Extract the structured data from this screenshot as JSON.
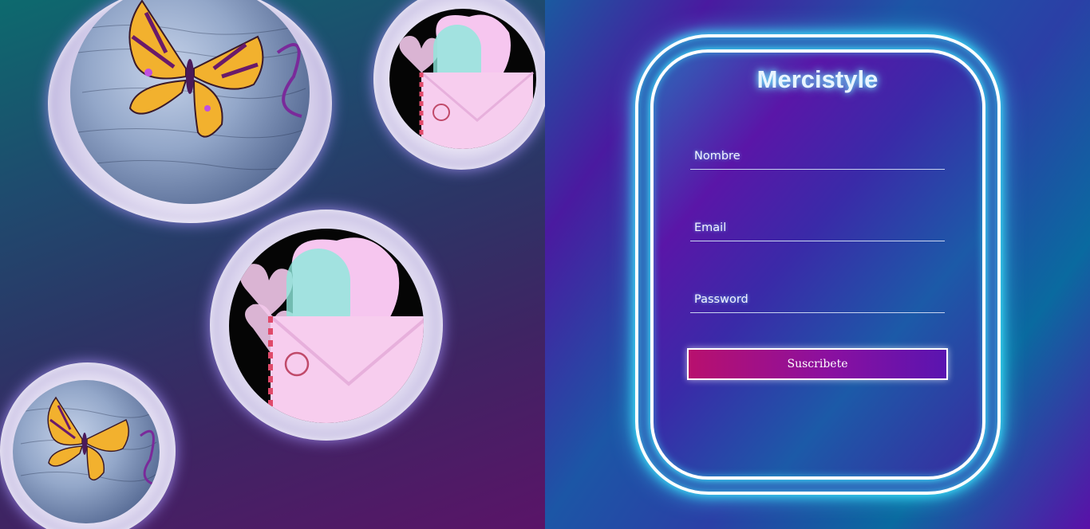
{
  "left_panel": {
    "images": [
      {
        "name": "butterfly",
        "icon": "butterfly-icon"
      },
      {
        "name": "love-letter",
        "icon": "envelope-hearts-icon"
      },
      {
        "name": "love-letter-large",
        "icon": "envelope-hearts-icon"
      },
      {
        "name": "butterfly-small",
        "icon": "butterfly-icon"
      }
    ]
  },
  "form": {
    "brand": "Mercistyle",
    "fields": [
      {
        "label": "Nombre",
        "value": ""
      },
      {
        "label": "Email",
        "value": ""
      },
      {
        "label": "Password",
        "value": ""
      }
    ],
    "submit_label": "Suscribete"
  },
  "colors": {
    "neon": "#3fe8ff",
    "button_start": "#b8106e",
    "button_end": "#5a14b0"
  }
}
